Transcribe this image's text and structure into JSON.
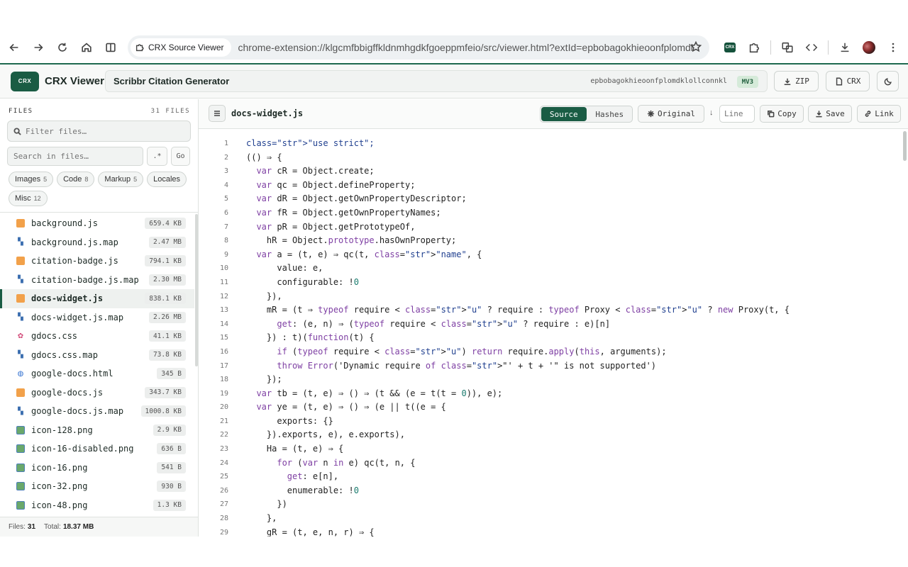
{
  "browser": {
    "site_chip": "CRX Source Viewer",
    "url": "chrome-extension://klgcmfbbigffkldnmhgdkfgoeppmfeio/src/viewer.html?extId=epbobagokhieoonfplomdklo..."
  },
  "header": {
    "logo": "CRX",
    "app_title": "CRX Viewer",
    "extension_name": "Scribbr Citation Generator",
    "extension_id": "epbobagokhieoonfplomdklollconnkl",
    "manifest_badge": "MV3",
    "zip_label": "ZIP",
    "crx_label": "CRX"
  },
  "sidebar": {
    "title": "FILES",
    "count": "31 FILES",
    "filter_placeholder": "Filter files…",
    "search_placeholder": "Search in files…",
    "regex_label": ".*",
    "go_label": "Go",
    "chips": [
      {
        "label": "Images",
        "count": "5"
      },
      {
        "label": "Code",
        "count": "8"
      },
      {
        "label": "Markup",
        "count": "5"
      },
      {
        "label": "Locales",
        "count": ""
      },
      {
        "label": "Misc",
        "count": "12"
      }
    ],
    "files": [
      {
        "name": "background.js",
        "size": "659.4 KB",
        "type": "js"
      },
      {
        "name": "background.js.map",
        "size": "2.47 MB",
        "type": "map"
      },
      {
        "name": "citation-badge.js",
        "size": "794.1 KB",
        "type": "js"
      },
      {
        "name": "citation-badge.js.map",
        "size": "2.30 MB",
        "type": "map"
      },
      {
        "name": "docs-widget.js",
        "size": "838.1 KB",
        "type": "js",
        "active": true
      },
      {
        "name": "docs-widget.js.map",
        "size": "2.26 MB",
        "type": "map"
      },
      {
        "name": "gdocs.css",
        "size": "41.1 KB",
        "type": "css"
      },
      {
        "name": "gdocs.css.map",
        "size": "73.8 KB",
        "type": "map"
      },
      {
        "name": "google-docs.html",
        "size": "345 B",
        "type": "html"
      },
      {
        "name": "google-docs.js",
        "size": "343.7 KB",
        "type": "js"
      },
      {
        "name": "google-docs.js.map",
        "size": "1000.8 KB",
        "type": "map"
      },
      {
        "name": "icon-128.png",
        "size": "2.9 KB",
        "type": "png"
      },
      {
        "name": "icon-16-disabled.png",
        "size": "636 B",
        "type": "png"
      },
      {
        "name": "icon-16.png",
        "size": "541 B",
        "type": "png"
      },
      {
        "name": "icon-32.png",
        "size": "930 B",
        "type": "png"
      },
      {
        "name": "icon-48.png",
        "size": "1.3 KB",
        "type": "png"
      }
    ],
    "footer": {
      "files_label": "Files:",
      "files_value": "31",
      "total_label": "Total:",
      "total_value": "18.37 MB"
    }
  },
  "editor": {
    "current_file": "docs-widget.js",
    "view_source": "Source",
    "view_hashes": "Hashes",
    "original_label": "Original",
    "line_placeholder": "Line",
    "copy_label": "Copy",
    "save_label": "Save",
    "link_label": "Link",
    "lines": [
      "<span class=\"str\">class=\"str\"&gt;\"use strict\";</span>",
      "(() ⇒ {",
      "  <span class=\"kw\">var</span> cR = Object.create;",
      "  <span class=\"kw\">var</span> qc = Object.defineProperty;",
      "  <span class=\"kw\">var</span> dR = Object.getOwnPropertyDescriptor;",
      "  <span class=\"kw\">var</span> fR = Object.getOwnPropertyNames;",
      "  <span class=\"kw\">var</span> pR = Object.getPrototypeOf,",
      "    hR = Object.<span class=\"kw\">prototype</span>.hasOwnProperty;",
      "  <span class=\"kw\">var</span> a = (t, e) ⇒ qc(t, <span class=\"kw\">class</span>=<span class=\"str\">\"str\"</span>&gt;<span class=\"str\">\"name\"</span>, {",
      "      value: e,",
      "      configurable: !<span class=\"num\">0</span>",
      "    }),",
      "    mR = (t ⇒ <span class=\"kw\">typeof</span> require &lt; <span class=\"kw\">class</span>=<span class=\"str\">\"str\"</span>&gt;<span class=\"str\">\"u\"</span> ? require : <span class=\"kw\">typeof</span> Proxy &lt; <span class=\"kw\">class</span>=<span class=\"str\">\"str\"</span>&gt;<span class=\"str\">\"u\"</span> ? <span class=\"kw\">new</span> Proxy(t, {",
      "      <span class=\"kw\">get</span>: (e, n) ⇒ (<span class=\"kw\">typeof</span> require &lt; <span class=\"kw\">class</span>=<span class=\"str\">\"str\"</span>&gt;<span class=\"str\">\"u\"</span> ? require : e)[n]",
      "    }) : t)(<span class=\"kw\">function</span>(t) {",
      "      <span class=\"kw\">if</span> (<span class=\"kw\">typeof</span> require &lt; <span class=\"kw\">class</span>=<span class=\"str\">\"str\"</span>&gt;<span class=\"str\">\"u\"</span>) <span class=\"kw\">return</span> require.<span class=\"kw\">apply</span>(<span class=\"kw\">this</span>, arguments);",
      "      <span class=\"kw\">throw</span> <span class=\"kw\">Error</span>('Dynamic require <span class=\"kw\">of</span> <span class=\"kw\">class</span>=<span class=\"str\">\"str\"</span>&gt;\"' + t + '\" is not supported')",
      "    });",
      "  <span class=\"kw\">var</span> tb = (t, e) ⇒ () ⇒ (t &amp;&amp; (e = t(t = <span class=\"num\">0</span>)), e);",
      "  <span class=\"kw\">var</span> ye = (t, e) ⇒ () ⇒ (e || t((e = {",
      "      exports: {}",
      "    }).exports, e), e.exports),",
      "    Ha = (t, e) ⇒ {",
      "      <span class=\"kw\">for</span> (<span class=\"kw\">var</span> n <span class=\"kw\">in</span> e) qc(t, n, {",
      "        <span class=\"kw\">get</span>: e[n],",
      "        enumerable: !<span class=\"num\">0</span>",
      "      })",
      "    },",
      "    gR = (t, e, n, r) ⇒ {"
    ]
  }
}
